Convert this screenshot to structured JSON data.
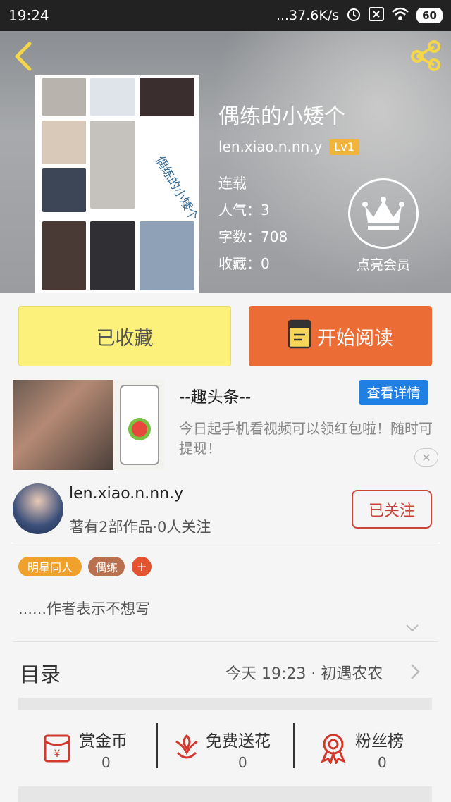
{
  "status_bar": {
    "time": "19:24",
    "network_speed": "...37.6K/s",
    "battery": "60"
  },
  "book": {
    "title": "偶练的小矮个",
    "author": "len.xiao.n.nn.y",
    "level": "Lv1",
    "status": "连载",
    "popularity": "人气：3",
    "word_count": "字数：708",
    "favorites": "收藏：0",
    "cover_text": "偶练的小矮个"
  },
  "vip": {
    "label": "点亮会员"
  },
  "actions": {
    "collected_label": "已收藏",
    "read_label": "开始阅读"
  },
  "ad": {
    "title": "--趣头条--",
    "detail_label": "查看详情",
    "description": "今日起手机看视频可以领红包啦！随时可提现！",
    "close": "✕"
  },
  "author_card": {
    "name": "len.xiao.n.nn.y",
    "subtitle": "著有2部作品·0人关注",
    "follow_label": "已关注"
  },
  "tags": [
    {
      "label": "明星同人",
      "color": "#f0a12c"
    },
    {
      "label": "偶练",
      "color": "#b9704f"
    }
  ],
  "tag_add": "+",
  "summary": "......作者表示不想写",
  "toc": {
    "label": "目录",
    "latest": "今天 19:23 · 初遇农农"
  },
  "stats": [
    {
      "label": "赏金币",
      "value": "0",
      "icon": "red-envelope-icon"
    },
    {
      "label": "免费送花",
      "value": "0",
      "icon": "flower-icon"
    },
    {
      "label": "粉丝榜",
      "value": "0",
      "icon": "medal-icon"
    }
  ],
  "colors": {
    "accent": "#ec6c36",
    "collected": "#fbf17b",
    "follow": "#c9453a",
    "link_blue": "#1f7fe3",
    "icon_red": "#d2392c",
    "back_yellow": "#f5d64a"
  }
}
